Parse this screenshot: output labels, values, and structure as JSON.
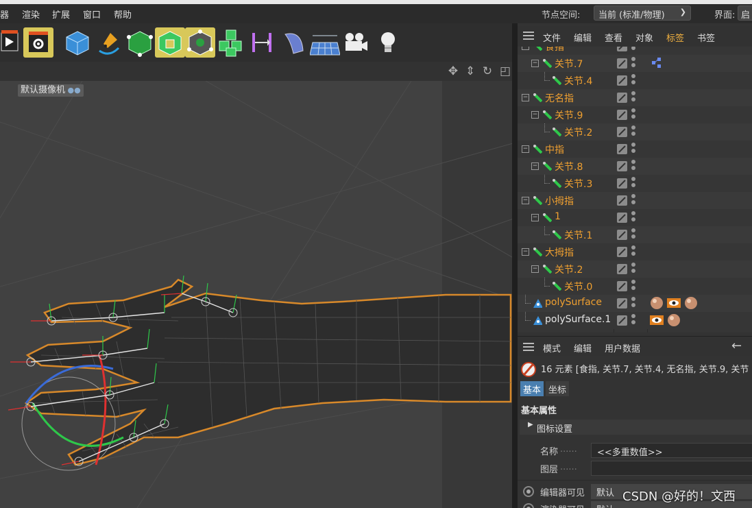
{
  "menu": {
    "items": [
      "器",
      "渲染",
      "扩展",
      "窗口",
      "帮助"
    ],
    "node_space_label": "节点空间:",
    "node_space_value": "当前 (标准/物理)",
    "layout_label": "界面:",
    "layout_value": "启"
  },
  "toolbar": {
    "icons": [
      "render-view-icon",
      "render-settings-icon",
      "cube-icon",
      "pen-spline-icon",
      "subdivision-icon",
      "extrude-icon",
      "volume-icon",
      "cloner-icon",
      "deformer-icon",
      "field-icon",
      "floor-icon",
      "camera-icon",
      "light-icon"
    ]
  },
  "viewport": {
    "camera_label": "默认摄像机",
    "nav_icons": [
      "move-view-icon",
      "zoom-view-icon",
      "rotate-view-icon",
      "toggle-view-icon"
    ]
  },
  "object_manager": {
    "menu": [
      "文件",
      "编辑",
      "查看",
      "对象",
      "标签",
      "书签"
    ],
    "rows": [
      {
        "name": "食指",
        "depth": 0,
        "color": "orange",
        "icon": "joint-icon"
      },
      {
        "name": "关节.7",
        "depth": 1,
        "color": "orange",
        "icon": "joint-icon",
        "tag": "ik-tag-icon"
      },
      {
        "name": "关节.4",
        "depth": 2,
        "color": "orange",
        "icon": "joint-icon"
      },
      {
        "name": "无名指",
        "depth": 0,
        "color": "orange",
        "icon": "joint-icon"
      },
      {
        "name": "关节.9",
        "depth": 1,
        "color": "orange",
        "icon": "joint-icon"
      },
      {
        "name": "关节.2",
        "depth": 2,
        "color": "orange",
        "icon": "joint-icon"
      },
      {
        "name": "中指",
        "depth": 0,
        "color": "orange",
        "icon": "joint-icon"
      },
      {
        "name": "关节.8",
        "depth": 1,
        "color": "orange",
        "icon": "joint-icon"
      },
      {
        "name": "关节.3",
        "depth": 2,
        "color": "orange",
        "icon": "joint-icon"
      },
      {
        "name": "小拇指",
        "depth": 0,
        "color": "orange",
        "icon": "joint-icon"
      },
      {
        "name": "1",
        "depth": 1,
        "color": "orange",
        "icon": "joint-icon"
      },
      {
        "name": "关节.1",
        "depth": 2,
        "color": "orange",
        "icon": "joint-icon"
      },
      {
        "name": "大拇指",
        "depth": 0,
        "color": "orange",
        "icon": "joint-icon"
      },
      {
        "name": "关节.2",
        "depth": 1,
        "color": "orange",
        "icon": "joint-icon"
      },
      {
        "name": "关节.0",
        "depth": 2,
        "color": "orange",
        "icon": "joint-icon"
      },
      {
        "name": "polySurface",
        "depth": 0,
        "color": "orange",
        "icon": "poly-icon",
        "tags": [
          "material-ball-icon",
          "display-tag-icon",
          "material-ball-icon"
        ]
      },
      {
        "name": "polySurface.1",
        "depth": 0,
        "color": "white",
        "icon": "poly-icon",
        "tags": [
          "display-tag-icon",
          "material-ball-icon"
        ]
      }
    ]
  },
  "attribute_manager": {
    "menu": [
      "模式",
      "编辑",
      "用户数据"
    ],
    "info": "16 元素 [食指, 关节.7, 关节.4, 无名指, 关节.9, 关节",
    "tabs": [
      "基本",
      "坐标"
    ],
    "section_title": "基本属性",
    "group_title": "图标设置",
    "fields": {
      "name_label": "名称",
      "name_value": "<<多重数值>>",
      "layer_label": "图层",
      "editor_visible_label": "编辑器可见",
      "editor_visible_value": "默认",
      "render_visible_label": "渲染器可见",
      "render_visible_value": "默认"
    }
  },
  "watermark": "CSDN @好的！文西",
  "colors": {
    "orange_text": "#f0a030",
    "active_tab": "#4a7fb0",
    "menu_bg": "#2b2b2b",
    "viewport_bg": "#414141"
  }
}
